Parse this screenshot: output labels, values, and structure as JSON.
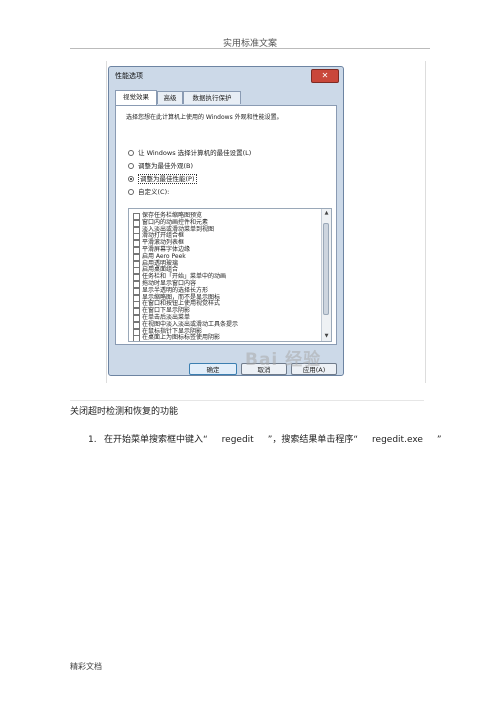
{
  "header": {
    "text": "实用标准文案"
  },
  "dialog": {
    "title": "性能选项",
    "close_glyph": "✕",
    "tabs": [
      "视觉效果",
      "高级",
      "数据执行保护"
    ],
    "instruction": "选择您想在此计算机上使用的 Windows 外观和性能设置。",
    "radios": [
      {
        "label": "让 Windows 选择计算机的最佳设置(L)",
        "checked": false
      },
      {
        "label": "调整为最佳外观(B)",
        "checked": false
      },
      {
        "label": "调整为最佳性能(P)",
        "checked": true
      },
      {
        "label": "自定义(C):",
        "checked": false
      }
    ],
    "options": [
      "保存任务栏缩略图预览",
      "窗口内的动画控件和元素",
      "淡入淡出或滑动菜单到视图",
      "滑动打开组合框",
      "平滑滚动列表框",
      "平滑屏幕字体边缘",
      "启用 Aero Peek",
      "启用透明玻璃",
      "启用桌面组合",
      "任务栏和「开始」菜单中的动画",
      "拖动时显示窗口内容",
      "显示半透明的选择长方形",
      "显示缩略图，而不是显示图标",
      "在窗口和按钮上使用视觉样式",
      "在窗口下显示阴影",
      "在单击后淡出菜单",
      "在视图中淡入淡出或滑动工具条提示",
      "在鼠标指针下显示阴影",
      "在桌面上为图标标签使用阴影"
    ],
    "buttons": {
      "ok": "确定",
      "cancel": "取消",
      "apply": "应用(A)"
    }
  },
  "watermark": "Bai 经验",
  "caption": "关闭超时检测和恢复的功能",
  "step": {
    "number": "1.",
    "part1": "在开始菜单搜索框中键入“",
    "term1": "regedit",
    "part2": "”，搜索结果单击程序“",
    "term2": "regedit.exe",
    "part3": "”"
  },
  "footer": {
    "text": "精彩文档"
  }
}
